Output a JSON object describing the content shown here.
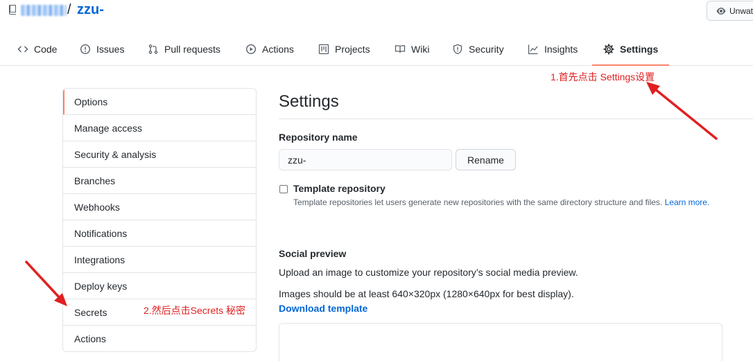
{
  "repo": {
    "separator": "/",
    "name": "zzu-"
  },
  "watch_button": {
    "label": "Unwat"
  },
  "tabs": [
    {
      "label": "Code",
      "icon": "code-icon"
    },
    {
      "label": "Issues",
      "icon": "issue-icon"
    },
    {
      "label": "Pull requests",
      "icon": "pull-request-icon"
    },
    {
      "label": "Actions",
      "icon": "play-icon"
    },
    {
      "label": "Projects",
      "icon": "project-icon"
    },
    {
      "label": "Wiki",
      "icon": "book-icon"
    },
    {
      "label": "Security",
      "icon": "shield-icon"
    },
    {
      "label": "Insights",
      "icon": "graph-icon"
    },
    {
      "label": "Settings",
      "icon": "gear-icon"
    }
  ],
  "sidebar": {
    "items": [
      {
        "label": "Options"
      },
      {
        "label": "Manage access"
      },
      {
        "label": "Security & analysis"
      },
      {
        "label": "Branches"
      },
      {
        "label": "Webhooks"
      },
      {
        "label": "Notifications"
      },
      {
        "label": "Integrations"
      },
      {
        "label": "Deploy keys"
      },
      {
        "label": "Secrets"
      },
      {
        "label": "Actions"
      }
    ]
  },
  "main": {
    "title": "Settings",
    "repo_name_label": "Repository name",
    "repo_name_value": "zzu-",
    "rename_label": "Rename",
    "template_label": "Template repository",
    "template_note": "Template repositories let users generate new repositories with the same directory structure and files.",
    "learn_more": "Learn more.",
    "social_title": "Social preview",
    "social_desc": "Upload an image to customize your repository’s social media preview.",
    "social_size": "Images should be at least 640×320px (1280×640px for best display).",
    "download_template": "Download template"
  },
  "annotations": {
    "step1": "1.首先点击 Settings设置",
    "step2": "2.然后点击Secrets 秘密"
  },
  "colors": {
    "link": "#0366d6",
    "active_underline": "#f9826c",
    "annotation": "#e02020"
  }
}
